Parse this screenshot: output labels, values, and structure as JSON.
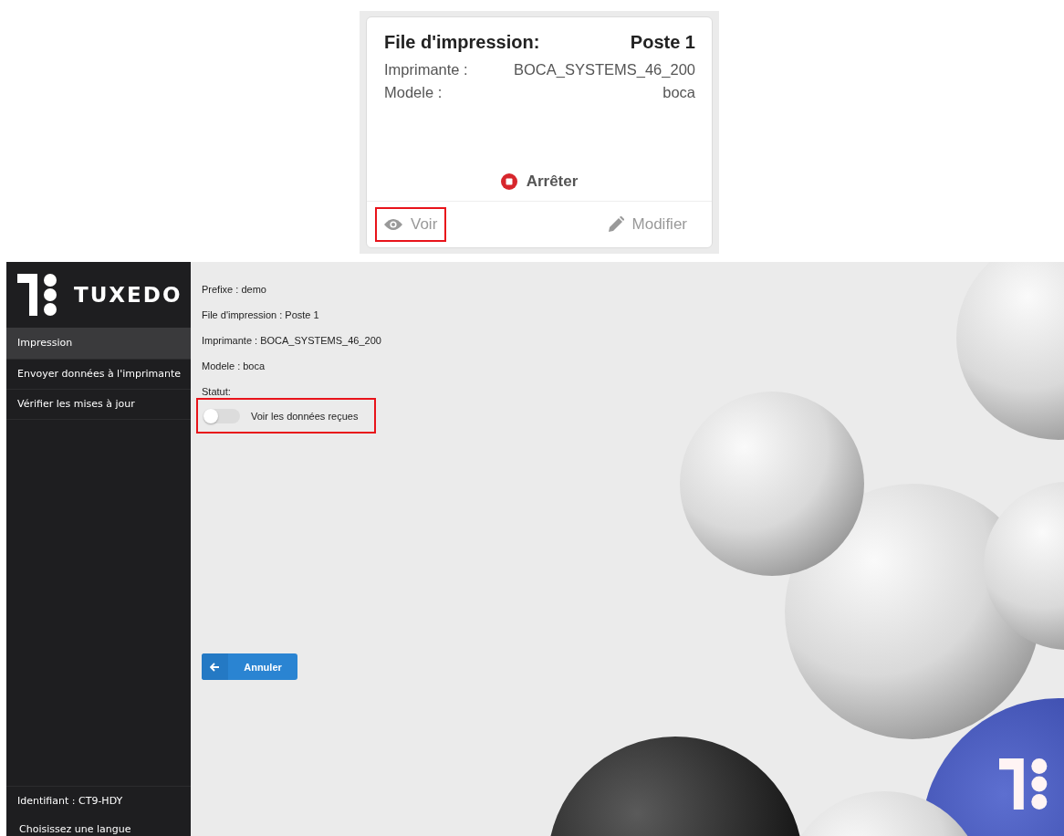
{
  "card": {
    "title": "File d'impression:",
    "queue": "Poste 1",
    "fields": [
      {
        "label": "Imprimante :",
        "value": "BOCA_SYSTEMS_46_200"
      },
      {
        "label": "Modele :",
        "value": "boca"
      }
    ],
    "stop_button": "Arrêter",
    "actions": [
      {
        "kind": "view",
        "label": "Voir",
        "highlighted": true
      },
      {
        "kind": "edit",
        "label": "Modifier",
        "highlighted": false
      }
    ]
  },
  "app": {
    "logo": "TUXEDO",
    "sidebar": {
      "items": [
        {
          "label": "Impression",
          "selected": true
        },
        {
          "label": "Envoyer données à l'imprimante",
          "selected": false
        },
        {
          "label": "Vérifier les mises à jour",
          "selected": false
        }
      ],
      "identifier": "Identifiant : CT9-HDY",
      "language": "Choisissez une langue"
    },
    "details": [
      "Prefixe : demo",
      "File d'impression : Poste 1",
      "Imprimante : BOCA_SYSTEMS_46_200",
      "Modele : boca",
      "Statut:"
    ],
    "toggle": {
      "label": "Voir les données reçues",
      "on": false,
      "highlighted": true
    },
    "cancel_button": "Annuler"
  }
}
